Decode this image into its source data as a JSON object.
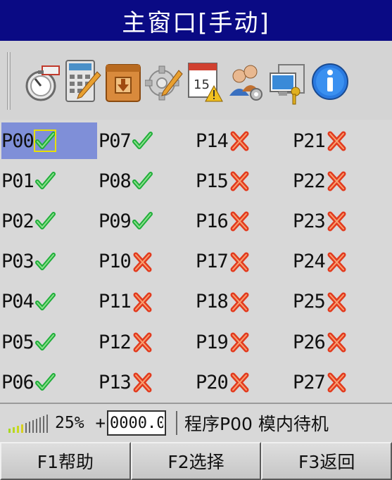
{
  "title": "主窗口[手动]",
  "toolbar": {
    "icons": [
      "stopwatch-icon",
      "calculator-edit-icon",
      "archive-box-icon",
      "settings-gear-icon",
      "calendar-warning-icon",
      "user-settings-icon",
      "computer-key-icon",
      "info-icon"
    ]
  },
  "programs": [
    [
      {
        "label": "P00",
        "enabled": true,
        "selected": true
      },
      {
        "label": "P07",
        "enabled": true
      },
      {
        "label": "P14",
        "enabled": false
      },
      {
        "label": "P21",
        "enabled": false
      }
    ],
    [
      {
        "label": "P01",
        "enabled": true
      },
      {
        "label": "P08",
        "enabled": true
      },
      {
        "label": "P15",
        "enabled": false
      },
      {
        "label": "P22",
        "enabled": false
      }
    ],
    [
      {
        "label": "P02",
        "enabled": true
      },
      {
        "label": "P09",
        "enabled": true
      },
      {
        "label": "P16",
        "enabled": false
      },
      {
        "label": "P23",
        "enabled": false
      }
    ],
    [
      {
        "label": "P03",
        "enabled": true
      },
      {
        "label": "P10",
        "enabled": false
      },
      {
        "label": "P17",
        "enabled": false
      },
      {
        "label": "P24",
        "enabled": false
      }
    ],
    [
      {
        "label": "P04",
        "enabled": true
      },
      {
        "label": "P11",
        "enabled": false
      },
      {
        "label": "P18",
        "enabled": false
      },
      {
        "label": "P25",
        "enabled": false
      }
    ],
    [
      {
        "label": "P05",
        "enabled": true
      },
      {
        "label": "P12",
        "enabled": false
      },
      {
        "label": "P19",
        "enabled": false
      },
      {
        "label": "P26",
        "enabled": false
      }
    ],
    [
      {
        "label": "P06",
        "enabled": true
      },
      {
        "label": "P13",
        "enabled": false
      },
      {
        "label": "P20",
        "enabled": false
      },
      {
        "label": "P27",
        "enabled": false
      }
    ]
  ],
  "status": {
    "signal_level": 0.25,
    "zoom_text": "25%",
    "plus_sign": "+",
    "counter_value": "0000.0",
    "program_status": "程序P00 模内待机"
  },
  "fkeys": [
    "F1帮助",
    "F2选择",
    "F3返回"
  ],
  "colors": {
    "title_bg": "#0a0a84",
    "selected_bg": "#7f8fd8",
    "check_green": "#1fae3a",
    "cross_red": "#e23a1e",
    "signal_active": [
      "#a8d820",
      "#b8d820",
      "#c8d820",
      "#d8d020"
    ]
  }
}
